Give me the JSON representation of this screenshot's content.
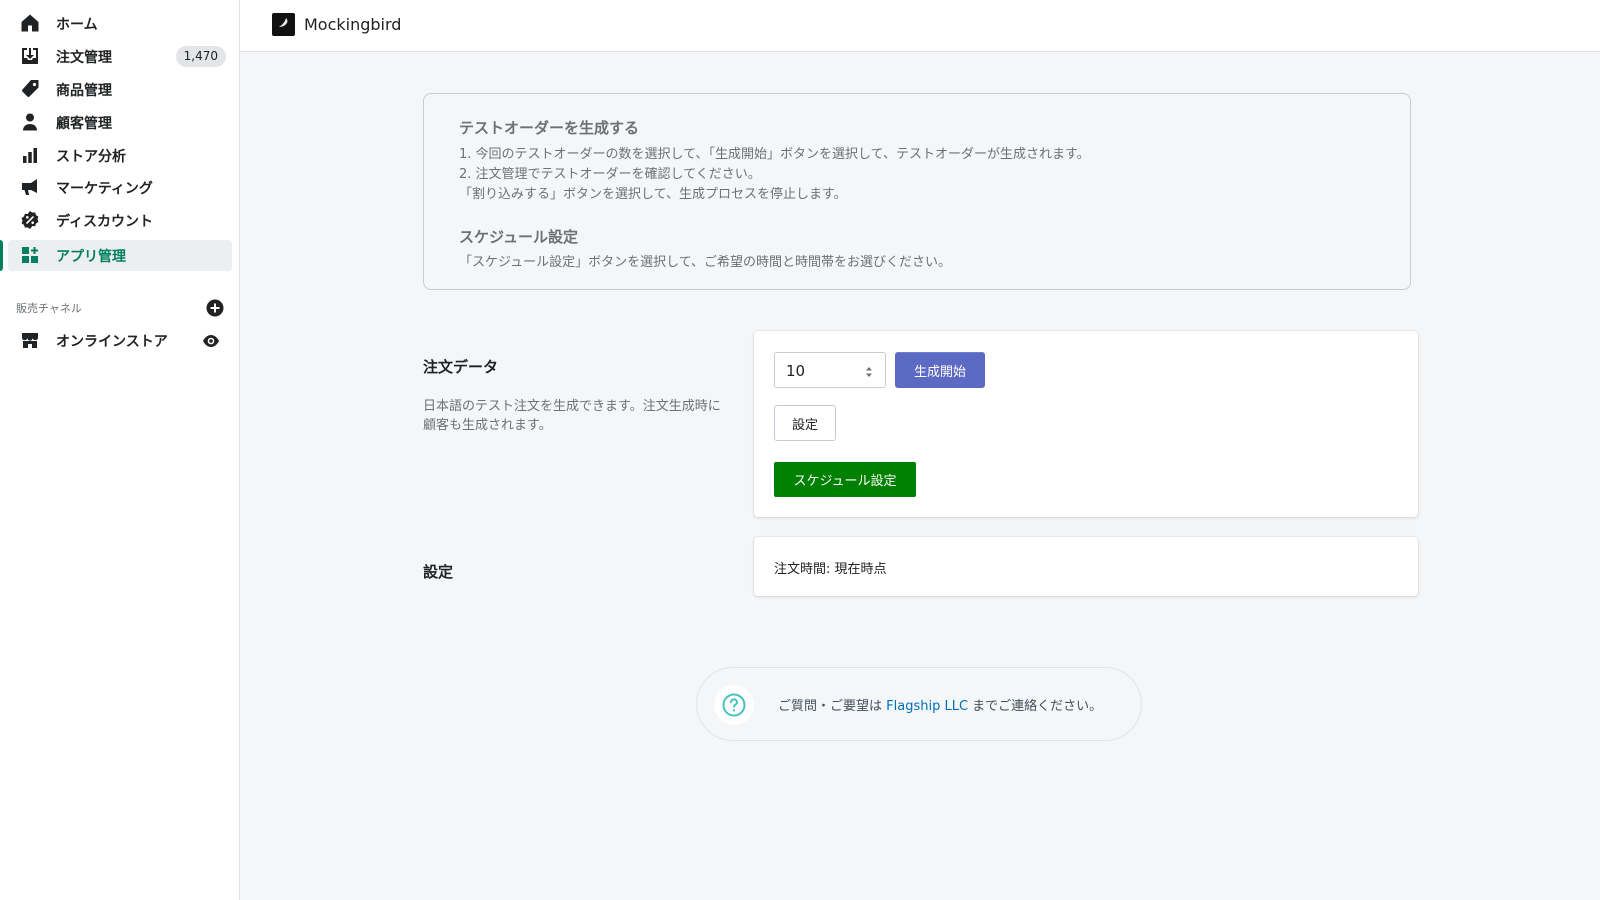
{
  "sidebar": {
    "items": [
      {
        "label": "ホーム",
        "icon": "home-icon"
      },
      {
        "label": "注文管理",
        "icon": "orders-icon",
        "badge": "1,470"
      },
      {
        "label": "商品管理",
        "icon": "tag-icon"
      },
      {
        "label": "顧客管理",
        "icon": "customer-icon"
      },
      {
        "label": "ストア分析",
        "icon": "analytics-icon"
      },
      {
        "label": "マーケティング",
        "icon": "megaphone-icon"
      },
      {
        "label": "ディスカウント",
        "icon": "discount-icon"
      },
      {
        "label": "アプリ管理",
        "icon": "apps-icon",
        "active": true
      }
    ],
    "channels_title": "販売チャネル",
    "channels": [
      {
        "label": "オンラインストア",
        "icon": "store-icon"
      }
    ]
  },
  "header": {
    "app_name": "Mockingbird"
  },
  "info": {
    "title1": "テストオーダーを生成する",
    "line1": "1. 今回のテストオーダーの数を選択して、「生成開始」ボタンを選択して、テストオーダーが生成されます。",
    "line2": "2. 注文管理でテストオーダーを確認してください。",
    "line3": "「割り込みする」ボタンを選択して、生成プロセスを停止します。",
    "title2": "スケジュール設定",
    "line4": "「スケジュール設定」ボタンを選択して、ご希望の時間と時間帯をお選びください。"
  },
  "order_section": {
    "title": "注文データ",
    "description": "日本語のテスト注文を生成できます。注文生成時に顧客も生成されます。",
    "quantity_value": "10",
    "start_label": "生成開始",
    "settings_label": "設定",
    "schedule_label": "スケジュール設定"
  },
  "settings_section": {
    "title": "設定",
    "order_time_text": "注文時間: 現在時点"
  },
  "help": {
    "prefix": "ご質問・ご要望は ",
    "link_text": "Flagship LLC",
    "suffix": " までご連絡ください。"
  },
  "colors": {
    "accent_green": "#008060",
    "primary_button": "#5c6ac4",
    "schedule_button": "#008000",
    "link": "#006fbb"
  }
}
